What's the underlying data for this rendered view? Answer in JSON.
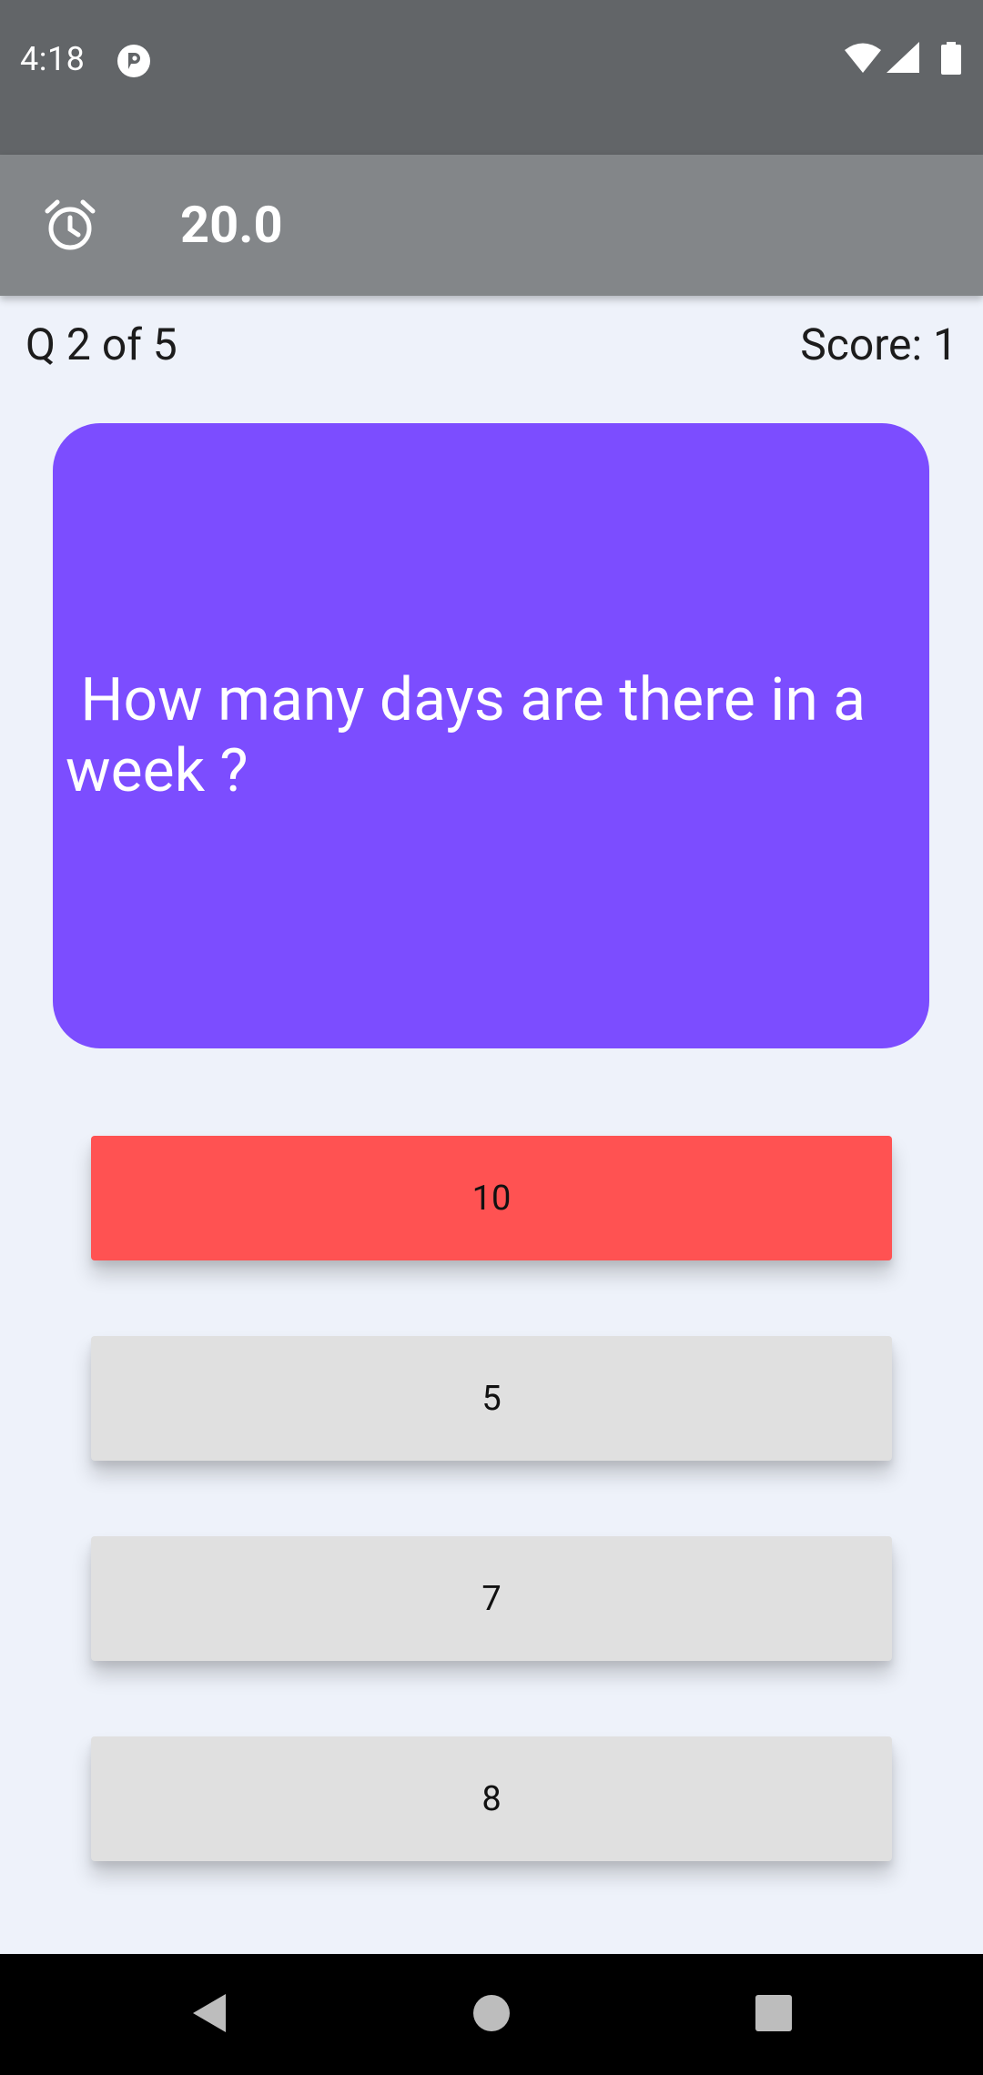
{
  "status_bar": {
    "time": "4:18",
    "icons": [
      "app-notification-icon",
      "wifi-icon",
      "cell-signal-icon",
      "battery-icon"
    ]
  },
  "app_bar": {
    "icon": "alarm-clock-icon",
    "timer": "20.0"
  },
  "quiz": {
    "progress": "Q 2 of 5",
    "score": "Score: 1",
    "question": " How many days are there in a week ?",
    "answers": [
      "10",
      "5",
      "7",
      "8"
    ],
    "selected_wrong_answer": "10"
  },
  "colors": {
    "status_bar": "#626568",
    "app_bar": "#838689",
    "background": "#eef2fa",
    "question_card": "#7c4dff",
    "wrong_answer": "#ff5252",
    "answer_default": "#e0e0e0"
  },
  "nav_bar": {
    "icons": [
      "back-icon",
      "home-icon",
      "recents-icon"
    ]
  }
}
